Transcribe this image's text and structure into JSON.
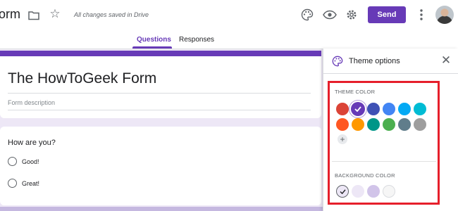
{
  "header": {
    "app_title": "orm",
    "save_status": "All changes saved in Drive",
    "send_label": "Send",
    "icons": [
      "folder-icon",
      "star-icon",
      "palette-icon",
      "eye-icon",
      "gear-icon",
      "more-vert-icon",
      "avatar"
    ]
  },
  "tabs": [
    {
      "label": "Questions",
      "active": true
    },
    {
      "label": "Responses",
      "active": false
    }
  ],
  "form": {
    "title": "The HowToGeek Form",
    "description_placeholder": "Form description",
    "question": "How are you?",
    "options": [
      "Good!",
      "Great!"
    ]
  },
  "theme_panel": {
    "title": "Theme options",
    "theme_color_label": "THEME COLOR",
    "theme_colors": [
      "#db4437",
      "#673ab7",
      "#3f51b5",
      "#4285f4",
      "#03a9f4",
      "#00bcd4",
      "#ff5722",
      "#ff9800",
      "#009688",
      "#4caf50",
      "#607d8b",
      "#9e9e9e"
    ],
    "selected_theme_color": "#673ab7",
    "add_label": "+",
    "background_color_label": "BACKGROUND COLOR",
    "background_colors": [
      "#ede7f6",
      "#ede7f6",
      "#d1c4e9",
      "#f6f6f6"
    ],
    "selected_background_index": 0
  },
  "colors": {
    "accent": "#673ab7",
    "highlight": "#e61f2b"
  }
}
